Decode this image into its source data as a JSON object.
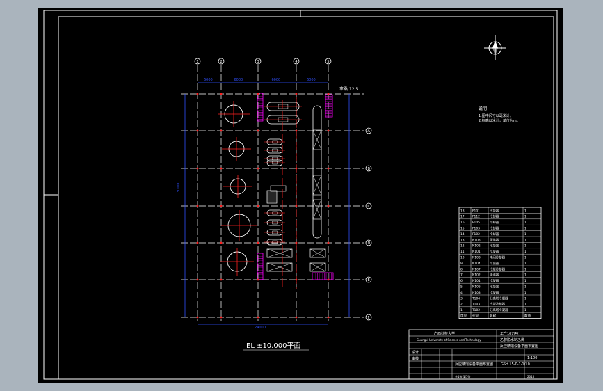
{
  "drawing": {
    "plan_title": "EL ±10.000平面",
    "note_top_label": "拿桑 12.5",
    "notes_heading": "说明：",
    "notes_lines": [
      "1.图中尺寸以毫米计。",
      "2.标高以米计，单位为m。"
    ],
    "grid_left_marks": [
      "1",
      "2",
      "3",
      "4",
      "5"
    ],
    "grid_right_marks": [
      "A",
      "B",
      "C",
      "D",
      "E",
      "F"
    ],
    "dimension_labels": [
      "6000",
      "6000",
      "6000",
      "6000"
    ],
    "overall_width": "24000",
    "overall_height": "30000"
  },
  "parts_list": {
    "header": [
      "序号",
      "代号",
      "名称",
      "数量"
    ],
    "rows": [
      [
        "18",
        "F101",
        "冷凝器",
        "1"
      ],
      [
        "17",
        "F112",
        "冷却器",
        "1"
      ],
      [
        "16",
        "F105",
        "冷却器",
        "1"
      ],
      [
        "15",
        "F103",
        "冷却器",
        "1"
      ],
      [
        "14",
        "F102",
        "冷却器",
        "1"
      ],
      [
        "13",
        "N105",
        "再沸器",
        "1"
      ],
      [
        "12",
        "N102",
        "冷凝器",
        "1"
      ],
      [
        "11",
        "N101",
        "冷凝器",
        "1"
      ],
      [
        "10",
        "N103",
        "中间冷却器",
        "1"
      ],
      [
        "9",
        "N104",
        "冷凝器",
        "1"
      ],
      [
        "8",
        "N107",
        "冷凝冷却器",
        "1"
      ],
      [
        "7",
        "N102",
        "再沸器",
        "1"
      ],
      [
        "6",
        "N101",
        "冷凝器",
        "1"
      ],
      [
        "5",
        "N106",
        "冷凝器",
        "1"
      ],
      [
        "4",
        "N103",
        "冷凝器",
        "1"
      ],
      [
        "3",
        "T104",
        "分离塔冷凝器",
        "1"
      ],
      [
        "2",
        "T103",
        "冷凝冷却器",
        "1"
      ],
      [
        "1",
        "T102",
        "分离塔冷凝器",
        "1"
      ]
    ]
  },
  "title_block": {
    "school": "广西科技大学",
    "school_en": "Guangxi University of Science and Technology",
    "project": "年产10万吨",
    "project_sub": "乙醇脱水制乙烯",
    "drawing_name": "反应精馏设备平面布置图",
    "drawing_no": "GSH 15-0-1-1/10",
    "scale": "1:100",
    "sheet": "共1张 第1张",
    "designer": "设计",
    "checker": "审核",
    "date": "2015"
  }
}
